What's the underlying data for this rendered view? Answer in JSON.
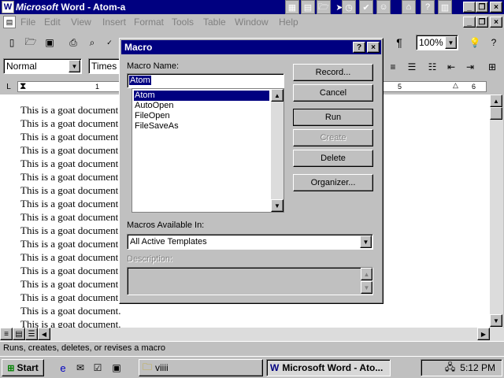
{
  "window": {
    "title": "Microsoft Word - Atom-a",
    "title_brand": "Microsoft",
    "title_rest": " Word - Atom-a",
    "app_icon": "W"
  },
  "menu": [
    "File",
    "Edit",
    "View",
    "Insert",
    "Format",
    "Tools",
    "Table",
    "Window",
    "Help"
  ],
  "menu_accel": [
    "F",
    "E",
    "V",
    "I",
    "o",
    "T",
    "a",
    "W",
    "H"
  ],
  "toolbar": {
    "zoom": "100%",
    "style": "Normal",
    "font": "Times N"
  },
  "ruler": {
    "marks": [
      "1",
      "5",
      "6"
    ]
  },
  "document": {
    "lines": [
      "This is a goat document.",
      "This is a goat document.",
      "This is a goat document.",
      "This is a goat document.",
      "This is a goat document.",
      "This is a goat document.",
      "This is a goat document.",
      "This is a goat document.",
      "This is a goat document.",
      "This is a goat document.",
      "This is a goat document.",
      "This is a goat document.",
      "This is a goat document.",
      "This is a goat document.",
      "This is a goat document.",
      "This is a goat document.",
      "This is a goat document."
    ]
  },
  "statusbar": {
    "text": "Runs, creates, deletes, or revises a macro"
  },
  "taskbar": {
    "start": "Start",
    "tasks": [
      {
        "label": "viiii"
      },
      {
        "label": "Microsoft Word - Ato..."
      }
    ],
    "clock": "5:12 PM"
  },
  "dialog": {
    "title": "Macro",
    "help_btn": "?",
    "close_btn": "×",
    "macro_name_label": "Macro Name:",
    "macro_name_accel": "M",
    "macro_name_value": "Atom",
    "macros": [
      "Atom",
      "AutoOpen",
      "FileOpen",
      "FileSaveAs"
    ],
    "selected_macro": "Atom",
    "buttons": {
      "record": "Record...",
      "cancel": "Cancel",
      "run": "Run",
      "create": "Create",
      "delete": "Delete",
      "organizer": "Organizer..."
    },
    "available_label": "Macros Available In:",
    "available_value": "All Active Templates",
    "description_label": "Description:"
  },
  "colors": {
    "titlebar": "#000080",
    "selection": "#000080",
    "face": "#c0c0c0"
  }
}
